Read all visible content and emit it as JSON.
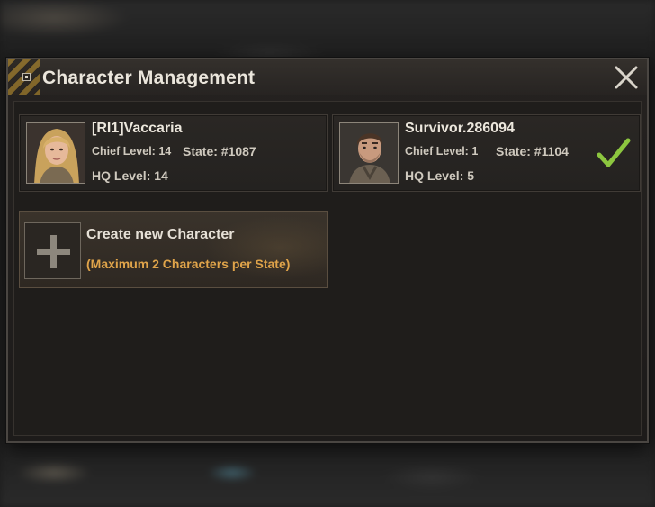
{
  "dialog": {
    "title": "Character Management",
    "close_icon": "close-x-icon"
  },
  "characters": [
    {
      "name": "[RI1]Vaccaria",
      "chief_level_text": "Chief Level: 14",
      "state_text": "State: #1087",
      "hq_level_text": "HQ Level: 14",
      "avatar_icon": "female-portrait",
      "active": false
    },
    {
      "name": "Survivor.286094",
      "chief_level_text": "Chief Level: 1",
      "state_text": "State: #1104",
      "hq_level_text": "HQ Level: 5",
      "avatar_icon": "male-portrait",
      "active": true
    }
  ],
  "create": {
    "label": "Create new Character",
    "note": "(Maximum 2 Characters per State)",
    "icon": "plus-icon"
  },
  "colors": {
    "accent_orange": "#e0a44a",
    "check_green": "#8cc63f",
    "title_text": "#ebe6dc"
  }
}
